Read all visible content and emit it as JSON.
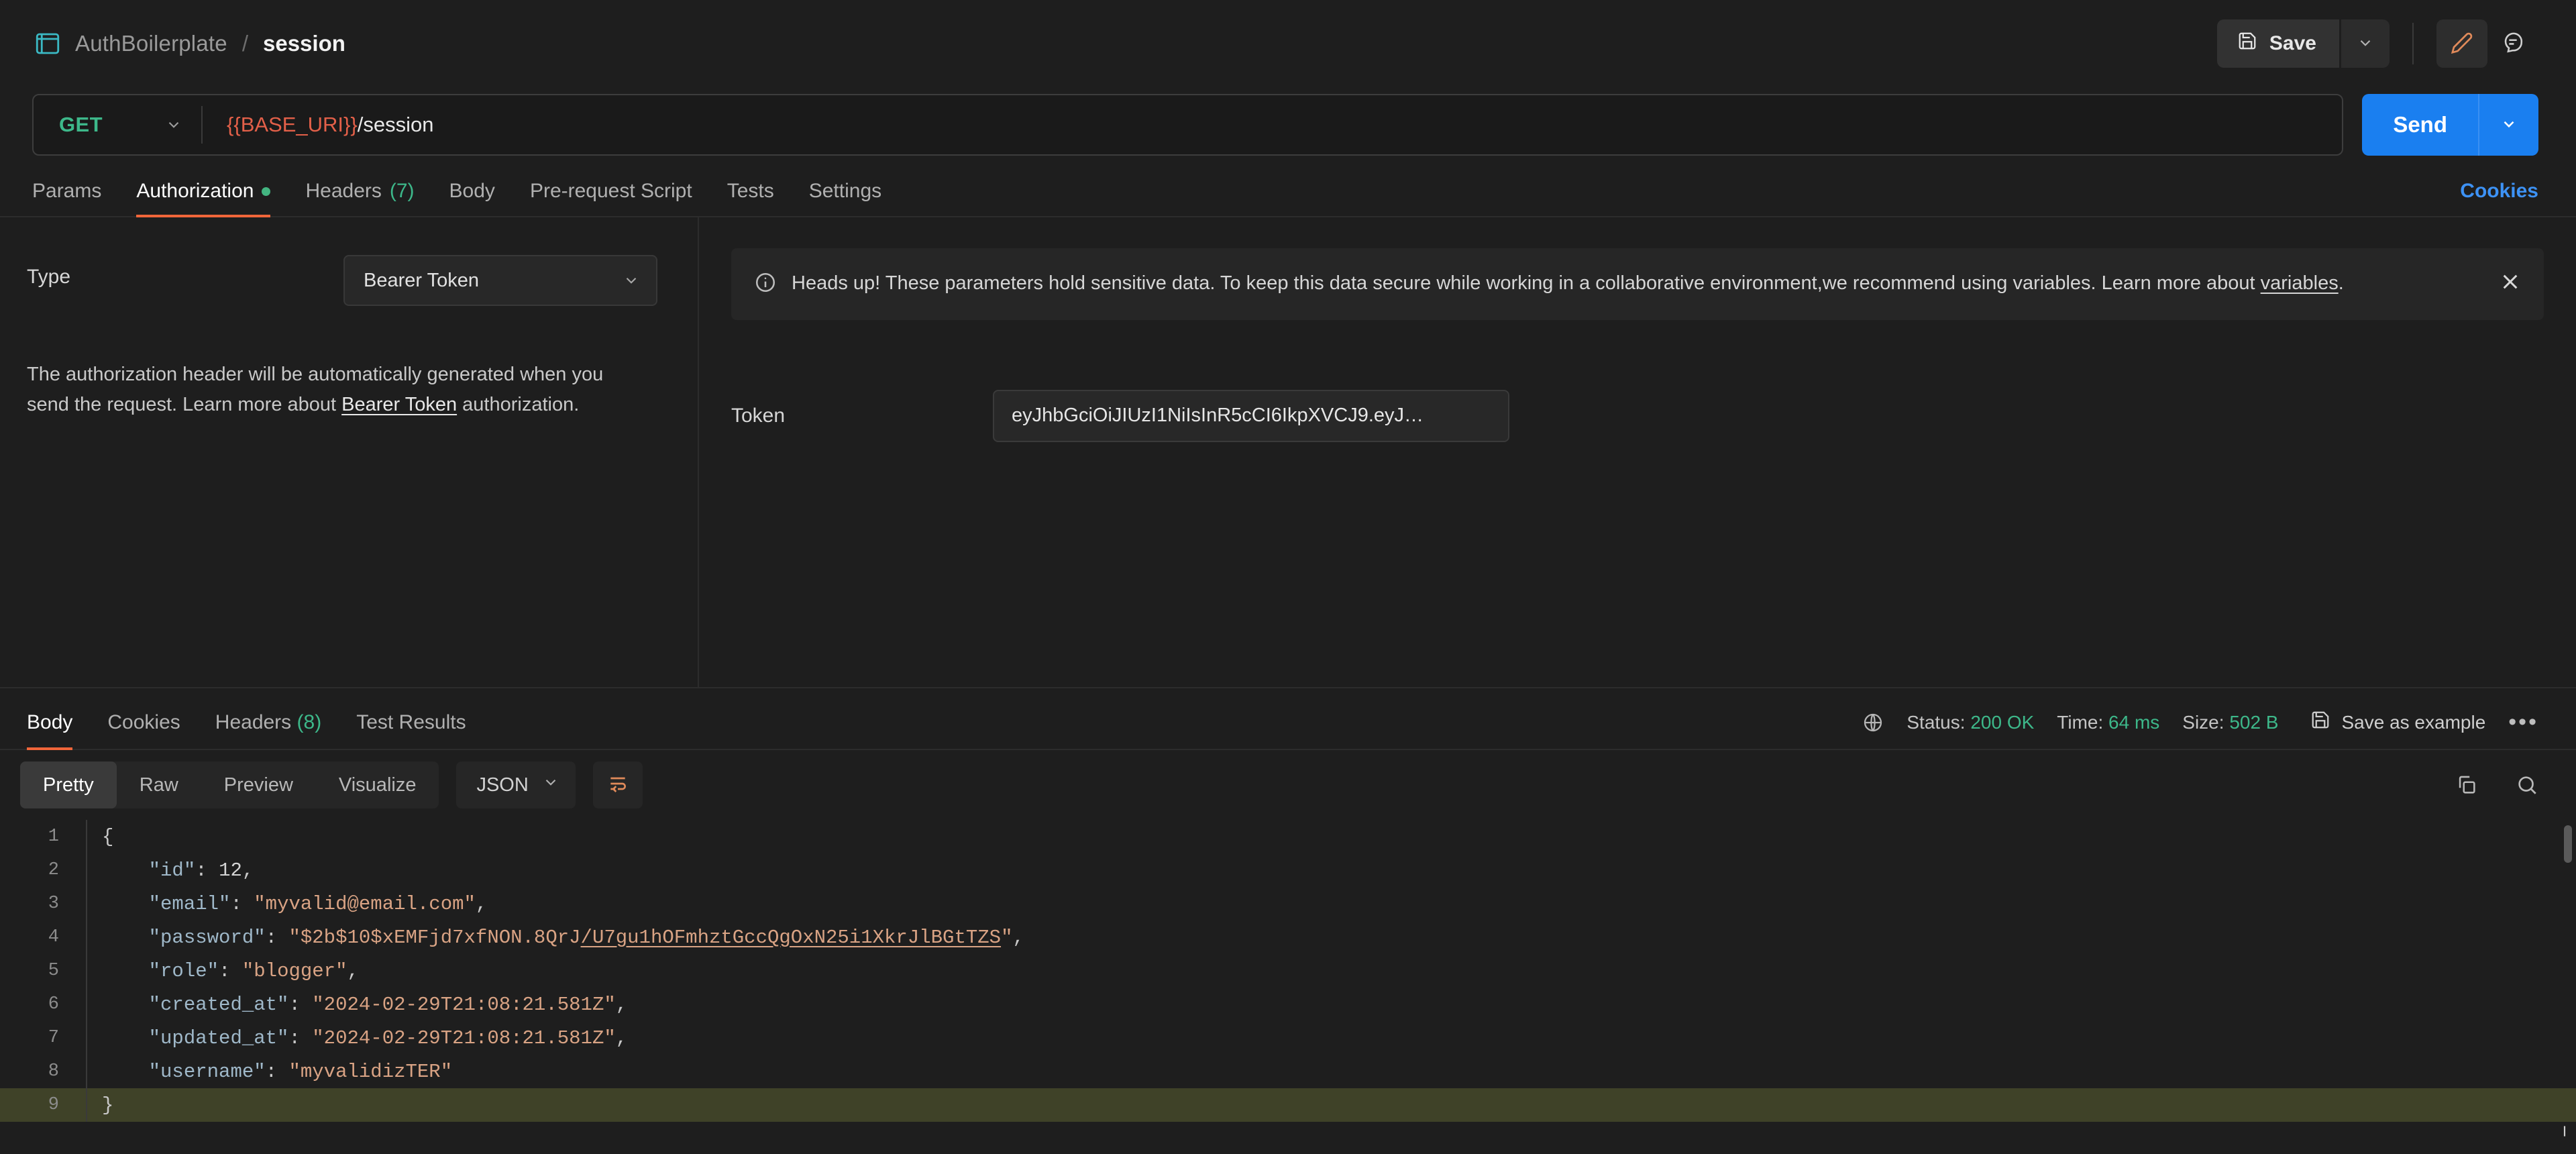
{
  "breadcrumb": {
    "icon": "http-icon",
    "parent": "AuthBoilerplate",
    "separator": "/",
    "current": "session"
  },
  "toolbar": {
    "save_label": "Save",
    "save_icon": "floppy-disk-icon",
    "save_caret_icon": "chevron-down-icon",
    "edit_icon": "pencil-icon",
    "comment_icon": "comment-icon"
  },
  "request": {
    "method": "GET",
    "url_variable": "{{BASE_URI}}",
    "url_path": "/session",
    "send_label": "Send",
    "send_color": "#1a7ff0",
    "method_color": "#3db88a",
    "variable_color": "#e36049"
  },
  "request_tabs": {
    "items": [
      {
        "label": "Params",
        "count": "",
        "active": false,
        "dot": false
      },
      {
        "label": "Authorization",
        "count": "",
        "active": true,
        "dot": true
      },
      {
        "label": "Headers",
        "count": "(7)",
        "active": false,
        "dot": false
      },
      {
        "label": "Body",
        "count": "",
        "active": false,
        "dot": false
      },
      {
        "label": "Pre-request Script",
        "count": "",
        "active": false,
        "dot": false
      },
      {
        "label": "Tests",
        "count": "",
        "active": false,
        "dot": false
      },
      {
        "label": "Settings",
        "count": "",
        "active": false,
        "dot": false
      }
    ],
    "cookies_link": "Cookies"
  },
  "auth": {
    "type_label": "Type",
    "type_value": "Bearer Token",
    "description_part1": "The authorization header will be automatically generated when you send the request. Learn more about ",
    "description_link": "Bearer Token",
    "description_part2": " authorization.",
    "token_label": "Token",
    "token_value": "eyJhbGciOiJIUzI1NiIsInR5cCI6IkpXVCJ9.eyJ…"
  },
  "banner": {
    "icon": "info-icon",
    "text_part1": "Heads up! These parameters hold sensitive data. To keep this data secure while working in a collaborative environment,we recommend using variables. Learn more about ",
    "link": "variables",
    "text_part2": ".",
    "close_icon": "close-icon"
  },
  "response_tabs": {
    "items": [
      {
        "label": "Body",
        "count": "",
        "active": true
      },
      {
        "label": "Cookies",
        "count": "",
        "active": false
      },
      {
        "label": "Headers",
        "count": "(8)",
        "active": false
      },
      {
        "label": "Test Results",
        "count": "",
        "active": false
      }
    ]
  },
  "response_status": {
    "globe_icon": "globe-icon",
    "status_label": "Status:",
    "status_value": "200 OK",
    "time_label": "Time:",
    "time_value": "64 ms",
    "size_label": "Size:",
    "size_value": "502 B",
    "save_example_label": "Save as example",
    "save_example_icon": "floppy-disk-icon",
    "more_icon": "ellipsis-icon",
    "ok_color": "#3db88a"
  },
  "view_toolbar": {
    "modes": [
      {
        "label": "Pretty",
        "active": true
      },
      {
        "label": "Raw",
        "active": false
      },
      {
        "label": "Preview",
        "active": false
      },
      {
        "label": "Visualize",
        "active": false
      }
    ],
    "format": "JSON",
    "format_caret_icon": "chevron-down-icon",
    "wrap_icon": "word-wrap-icon",
    "copy_icon": "copy-icon",
    "search_icon": "search-icon"
  },
  "response_body": {
    "language": "json",
    "lines": [
      {
        "num": "1",
        "tokens": [
          {
            "t": "{",
            "c": "p"
          }
        ],
        "highlight": false
      },
      {
        "num": "2",
        "tokens": [
          {
            "t": "    ",
            "c": "p"
          },
          {
            "t": "\"id\"",
            "c": "k"
          },
          {
            "t": ": ",
            "c": "p"
          },
          {
            "t": "12",
            "c": "n"
          },
          {
            "t": ",",
            "c": "p"
          }
        ],
        "highlight": false
      },
      {
        "num": "3",
        "tokens": [
          {
            "t": "    ",
            "c": "p"
          },
          {
            "t": "\"email\"",
            "c": "k"
          },
          {
            "t": ": ",
            "c": "p"
          },
          {
            "t": "\"myvalid@email.com\"",
            "c": "s"
          },
          {
            "t": ",",
            "c": "p"
          }
        ],
        "highlight": false
      },
      {
        "num": "4",
        "tokens": [
          {
            "t": "    ",
            "c": "p"
          },
          {
            "t": "\"password\"",
            "c": "k"
          },
          {
            "t": ": ",
            "c": "p"
          },
          {
            "t": "\"$2b$10$xEMFjd7xfNON.8QrJ",
            "c": "s"
          },
          {
            "t": "/U7gu1hOFmhztGccQgOxN25i1XkrJlBGtTZS",
            "c": "s u"
          },
          {
            "t": "\"",
            "c": "s"
          },
          {
            "t": ",",
            "c": "p"
          }
        ],
        "highlight": false
      },
      {
        "num": "5",
        "tokens": [
          {
            "t": "    ",
            "c": "p"
          },
          {
            "t": "\"role\"",
            "c": "k"
          },
          {
            "t": ": ",
            "c": "p"
          },
          {
            "t": "\"blogger\"",
            "c": "s"
          },
          {
            "t": ",",
            "c": "p"
          }
        ],
        "highlight": false
      },
      {
        "num": "6",
        "tokens": [
          {
            "t": "    ",
            "c": "p"
          },
          {
            "t": "\"created_at\"",
            "c": "k"
          },
          {
            "t": ": ",
            "c": "p"
          },
          {
            "t": "\"2024-02-29T21:08:21.581Z\"",
            "c": "s"
          },
          {
            "t": ",",
            "c": "p"
          }
        ],
        "highlight": false
      },
      {
        "num": "7",
        "tokens": [
          {
            "t": "    ",
            "c": "p"
          },
          {
            "t": "\"updated_at\"",
            "c": "k"
          },
          {
            "t": ": ",
            "c": "p"
          },
          {
            "t": "\"2024-02-29T21:08:21.581Z\"",
            "c": "s"
          },
          {
            "t": ",",
            "c": "p"
          }
        ],
        "highlight": false
      },
      {
        "num": "8",
        "tokens": [
          {
            "t": "    ",
            "c": "p"
          },
          {
            "t": "\"username\"",
            "c": "k"
          },
          {
            "t": ": ",
            "c": "p"
          },
          {
            "t": "\"myvalidizTER\"",
            "c": "s"
          }
        ],
        "highlight": false
      },
      {
        "num": "9",
        "tokens": [
          {
            "t": "}",
            "c": "p"
          }
        ],
        "highlight": true
      }
    ]
  }
}
